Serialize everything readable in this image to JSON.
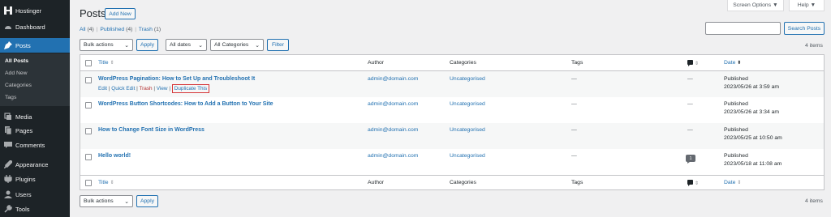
{
  "sidebar": {
    "site_name": "Hostinger",
    "items": [
      {
        "label": "Dashboard",
        "icon": "dashboard-icon"
      },
      {
        "label": "Posts",
        "icon": "pin-icon",
        "active": true
      },
      {
        "label": "Media",
        "icon": "media-icon"
      },
      {
        "label": "Pages",
        "icon": "pages-icon"
      },
      {
        "label": "Comments",
        "icon": "comments-icon"
      },
      {
        "label": "Appearance",
        "icon": "appearance-icon"
      },
      {
        "label": "Plugins",
        "icon": "plugins-icon"
      },
      {
        "label": "Users",
        "icon": "users-icon"
      },
      {
        "label": "Tools",
        "icon": "tools-icon"
      }
    ],
    "submenu": [
      "All Posts",
      "Add New",
      "Categories",
      "Tags"
    ]
  },
  "header": {
    "title": "Posts",
    "add_new": "Add New",
    "screen_options": "Screen Options ▼",
    "help": "Help ▼"
  },
  "views": {
    "all": "All",
    "all_count": "(4)",
    "published": "Published",
    "published_count": "(4)",
    "trash": "Trash",
    "trash_count": "(1)"
  },
  "search": {
    "button": "Search Posts",
    "value": ""
  },
  "filters": {
    "bulk_actions": "Bulk actions",
    "apply": "Apply",
    "dates": "All dates",
    "categories": "All Categories",
    "filter": "Filter",
    "items_count": "4 items"
  },
  "columns": {
    "title": "Title",
    "author": "Author",
    "categories": "Categories",
    "tags": "Tags",
    "date": "Date"
  },
  "row_actions": {
    "edit": "Edit",
    "quick_edit": "Quick Edit",
    "trash": "Trash",
    "view": "View",
    "duplicate": "Duplicate This"
  },
  "posts": [
    {
      "title": "WordPress Pagination: How to Set Up and Troubleshoot It",
      "author": "admin@domain.com",
      "category": "Uncategorised",
      "tags": "—",
      "comments": "—",
      "status": "Published",
      "date": "2023/05/26 at 3:59 am"
    },
    {
      "title": "WordPress Button Shortcodes: How to Add a Button to Your Site",
      "author": "admin@domain.com",
      "category": "Uncategorised",
      "tags": "—",
      "comments": "—",
      "status": "Published",
      "date": "2023/05/26 at 3:34 am"
    },
    {
      "title": "How to Change Font Size in WordPress",
      "author": "admin@domain.com",
      "category": "Uncategorised",
      "tags": "—",
      "comments": "—",
      "status": "Published",
      "date": "2023/05/25 at 10:50 am"
    },
    {
      "title": "Hello world!",
      "author": "admin@domain.com",
      "category": "Uncategorised",
      "tags": "—",
      "comments": "1",
      "status": "Published",
      "date": "2023/05/18 at 11:08 am"
    }
  ],
  "bottom": {
    "bulk_actions": "Bulk actions",
    "apply": "Apply",
    "items_count": "4 items"
  },
  "colors": {
    "sidebar": "#1d2327",
    "accent": "#2271b1",
    "highlight_box": "#d63638"
  }
}
